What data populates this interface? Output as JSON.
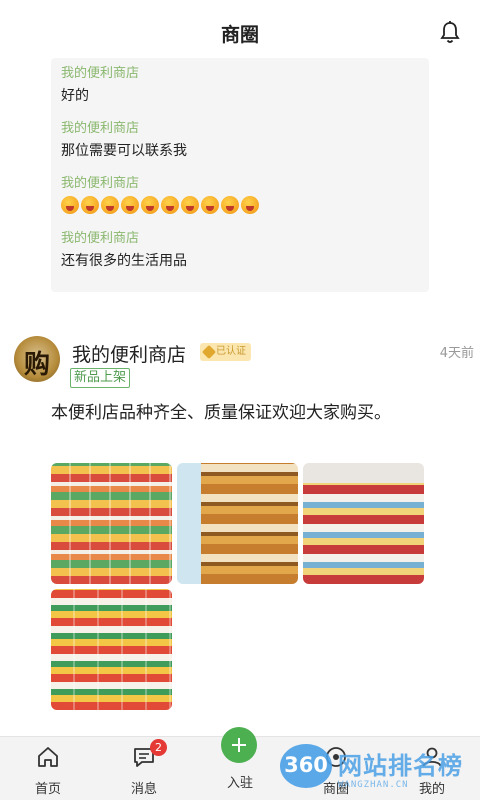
{
  "header": {
    "title": "商圈",
    "bell_icon": "bell-icon"
  },
  "comments": [
    {
      "author": "我的便利商店",
      "text": "好的"
    },
    {
      "author": "我的便利商店",
      "text": "那位需要可以联系我"
    },
    {
      "author": "我的便利商店",
      "emoji_count": 10,
      "emoji_icon": "laughing-face-emoji"
    },
    {
      "author": "我的便利商店",
      "text": "还有很多的生活用品"
    }
  ],
  "post": {
    "shop_name": "我的便利商店",
    "avatar_glyph": "购",
    "verified_label": "已认证",
    "time": "4天前",
    "tag": "新品上架",
    "content": "本便利店品种齐全、质量保证欢迎大家购买。",
    "photos": [
      "store-aisle-photo",
      "store-shelf-photo",
      "store-counter-photo",
      "store-snack-shelf-photo"
    ]
  },
  "tabbar": {
    "items": [
      {
        "label": "首页",
        "icon": "home-icon"
      },
      {
        "label": "消息",
        "icon": "message-icon",
        "badge": "2"
      },
      {
        "label": "入驻",
        "icon": "plus-icon"
      },
      {
        "label": "商圈",
        "icon": "shop-circle-icon"
      },
      {
        "label": "我的",
        "icon": "user-icon"
      }
    ]
  },
  "watermark": {
    "number": "360",
    "text": "网站排名榜",
    "sub": "WANGZHAN.CN"
  },
  "colors": {
    "accent_green": "#4caf50",
    "author_green": "#8ab86e",
    "badge_red": "#e53935",
    "verified_gold": "#c99a2e"
  }
}
